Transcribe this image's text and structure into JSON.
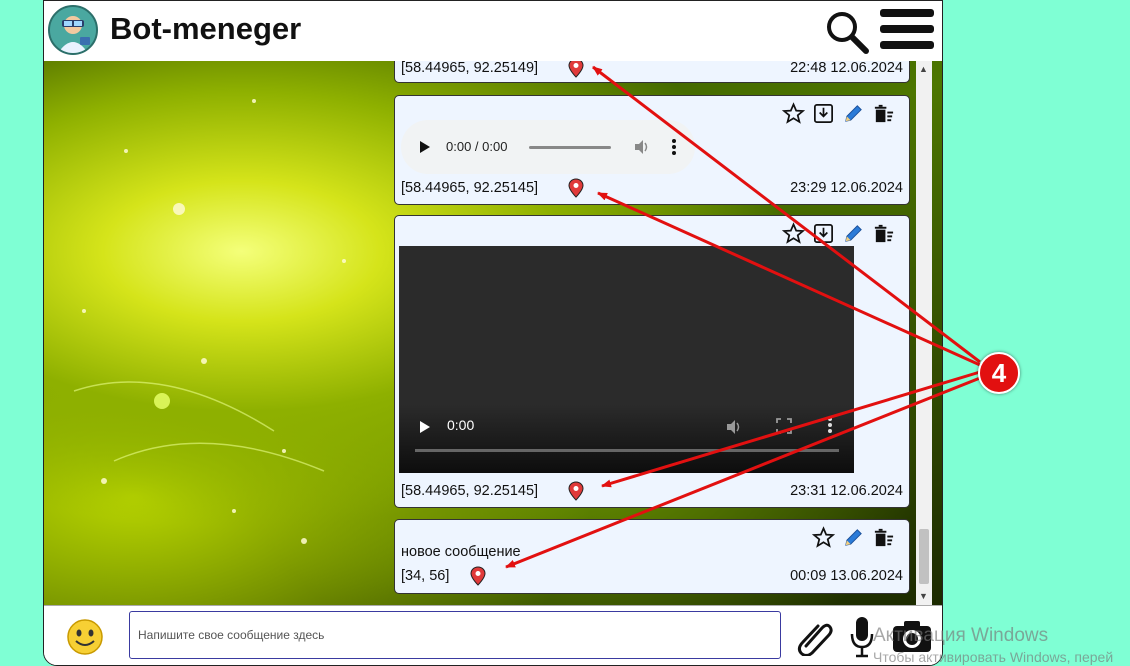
{
  "app": {
    "title": "Bot-meneger"
  },
  "header": {
    "avatar_icon": "bot-avatar",
    "search_icon": "search-icon",
    "menu_icon": "hamburger-icon"
  },
  "messages": [
    {
      "type": "partial",
      "coords": "[58.44965, 92.25149]",
      "time": "22:48 12.06.2024"
    },
    {
      "type": "audio",
      "coords": "[58.44965, 92.25145]",
      "time": "23:29 12.06.2024",
      "player_time": "0:00 / 0:00",
      "actions": [
        "star-icon",
        "download-icon",
        "edit-icon",
        "delete-icon"
      ]
    },
    {
      "type": "video",
      "coords": "[58.44965, 92.25145]",
      "time": "23:31 12.06.2024",
      "player_time": "0:00",
      "actions": [
        "star-icon",
        "download-icon",
        "edit-icon",
        "delete-icon"
      ]
    },
    {
      "type": "text",
      "text": "новое сообщение",
      "coords": "[34, 56]",
      "time": "00:09 13.06.2024",
      "actions": [
        "star-icon",
        "edit-icon",
        "delete-icon"
      ]
    }
  ],
  "composer": {
    "placeholder": "Напишите свое сообщение здесь"
  },
  "annotation": {
    "badge": "4"
  },
  "watermark": {
    "line1": "Активация Windows",
    "line2": "Чтобы активировать Windows, перей"
  },
  "colors": {
    "page_bg": "#7fffd4",
    "message_bg": "#eef5ff",
    "annotation_red": "#e21010"
  }
}
